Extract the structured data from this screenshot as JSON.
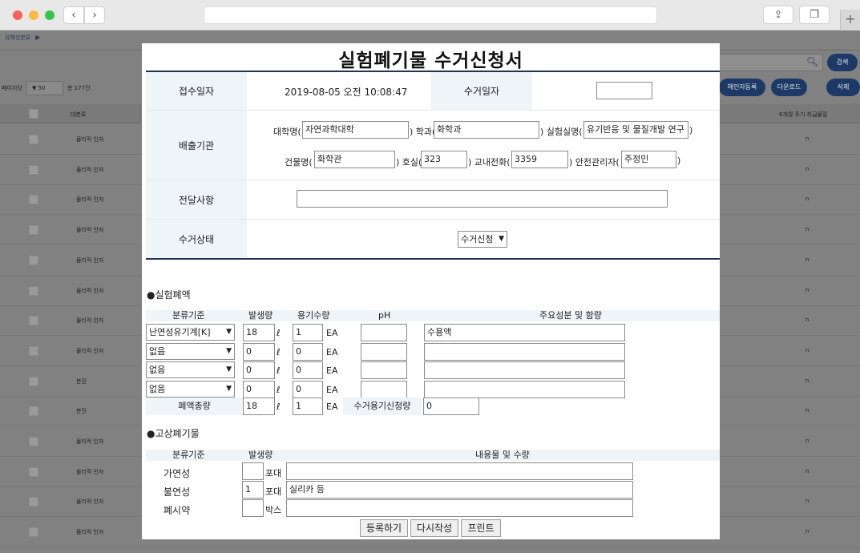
{
  "bg": {
    "breadcrumb": "유해성분류",
    "perpage_label": "페이지당",
    "perpage_value": "▼ 50",
    "total": "총 177건",
    "col_category": "대분류",
    "col_right": "6개월 주기 취급물질",
    "search_label": "검색",
    "btn_register": "해인자등록",
    "btn_download": "다운로드",
    "btn_delete": "삭제",
    "rows": [
      {
        "cat": "물리적 인자",
        "val": "n"
      },
      {
        "cat": "물리적 인자",
        "val": "n"
      },
      {
        "cat": "물리적 인자",
        "val": "n"
      },
      {
        "cat": "물리적 인자",
        "val": "n"
      },
      {
        "cat": "물리적 인자",
        "val": "n"
      },
      {
        "cat": "물리적 인자",
        "val": "n"
      },
      {
        "cat": "물리적 인자",
        "val": "n"
      },
      {
        "cat": "물리적 인자",
        "val": "n"
      },
      {
        "cat": "분진",
        "val": "n"
      },
      {
        "cat": "분진",
        "val": "n"
      },
      {
        "cat": "물리적 인자",
        "val": "n"
      },
      {
        "cat": "물리적 인자",
        "val": "n"
      },
      {
        "cat": "물리적 인자",
        "val": "n"
      },
      {
        "cat": "물리적 인자",
        "val": "n"
      }
    ]
  },
  "form": {
    "title": "실험폐기물 수거신청서",
    "receipt_label": "접수일자",
    "receipt_value": "2019-08-05 오전 10:08:47",
    "pickup_label": "수거일자",
    "pickup_value": "",
    "origin_label": "배출기관",
    "univ_label": "대학명(",
    "univ_value": "자연과학대학",
    "dept_label": ") 학과(",
    "dept_value": "화학과",
    "lab_label": ") 실험실명(",
    "lab_value": "유기반응 및 물질개발 연구",
    "close_paren": ")",
    "bldg_label": "건물명(",
    "bldg_value": "화학관",
    "room_label": ") 호실(",
    "room_value": "323",
    "phone_label": ") 교내전화(",
    "phone_value": "3359",
    "safety_label": ") 안전관리자(",
    "safety_value": "주정민",
    "message_label": "전달사항",
    "message_value": "",
    "status_label": "수거상태",
    "status_value": "수거신청"
  },
  "liquid": {
    "section": "●실험폐액",
    "h_class": "분류기준",
    "h_amount": "발생량",
    "h_containers": "용기수량",
    "h_ph": "pH",
    "h_components": "주요성분 및 함량",
    "unit_l": "ℓ",
    "unit_ea": "EA",
    "rows": [
      {
        "class": "난연성유기계[K]",
        "amount": "18",
        "containers": "1",
        "ph": "",
        "comp": "수용액"
      },
      {
        "class": "없음",
        "amount": "0",
        "containers": "0",
        "ph": "",
        "comp": ""
      },
      {
        "class": "없음",
        "amount": "0",
        "containers": "0",
        "ph": "",
        "comp": ""
      },
      {
        "class": "없음",
        "amount": "0",
        "containers": "0",
        "ph": "",
        "comp": ""
      }
    ],
    "total_label": "폐액총량",
    "total_amount": "18",
    "total_containers": "1",
    "container_req_label": "수거용기신청량",
    "container_req_value": "0"
  },
  "solid": {
    "section": "●고상폐기물",
    "h_class": "분류기준",
    "h_amount": "발생량",
    "h_contents": "내용물 및 수량",
    "rows": [
      {
        "class": "가연성",
        "amount": "",
        "unit": "포대",
        "contents": ""
      },
      {
        "class": "불연성",
        "amount": "1",
        "unit": "포대",
        "contents": "실리카 등"
      },
      {
        "class": "폐시약",
        "amount": "",
        "unit": "박스",
        "contents": ""
      }
    ]
  },
  "actions": {
    "register": "등록하기",
    "rewrite": "다시작성",
    "print": "프린트"
  }
}
